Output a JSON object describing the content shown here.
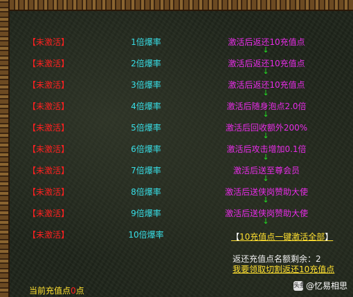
{
  "rows": [
    {
      "status": "未激活",
      "rate": "1倍爆率",
      "reward": "激活后返还10充值点"
    },
    {
      "status": "未激活",
      "rate": "2倍爆率",
      "reward": "激活后返还10充值点"
    },
    {
      "status": "未激活",
      "rate": "3倍爆率",
      "reward": "激活后返还10充值点"
    },
    {
      "status": "未激活",
      "rate": "4倍爆率",
      "reward": "激活后随身泡点2.0倍"
    },
    {
      "status": "未激活",
      "rate": "5倍爆率",
      "reward": "激活后回收额外200%"
    },
    {
      "status": "未激活",
      "rate": "6倍爆率",
      "reward": "激活后攻击增加0.1倍"
    },
    {
      "status": "未激活",
      "rate": "7倍爆率",
      "reward": "激活后送至尊会员"
    },
    {
      "status": "未激活",
      "rate": "8倍爆率",
      "reward": "激活后送侠岗赞助大使"
    },
    {
      "status": "未激活",
      "rate": "9倍爆率",
      "reward": "激活后送侠岗赞助大使"
    },
    {
      "status": "未激活",
      "rate": "10倍爆率",
      "reward": ""
    }
  ],
  "arrow_glyph": "↓",
  "bracket_left": "【",
  "bracket_right": "】",
  "activate_all": {
    "bracket_open": "【",
    "label": "10充值点一键激活全部",
    "bracket_close": "】"
  },
  "remaining_text": "返还充值点名额剩余：2",
  "claim_link": "我要领取切割返还10充值点",
  "current_points": {
    "label": "当前充值点",
    "value": "0",
    "unit": "点"
  },
  "watermark": {
    "icon": "toutiao-badge-icon",
    "badge_text": "头条",
    "author": "@忆易相思"
  },
  "colors": {
    "status": "#ff2020",
    "rate": "#38e0e8",
    "reward": "#e82ce8",
    "arrow": "#22dd22",
    "link": "#ffe030"
  }
}
